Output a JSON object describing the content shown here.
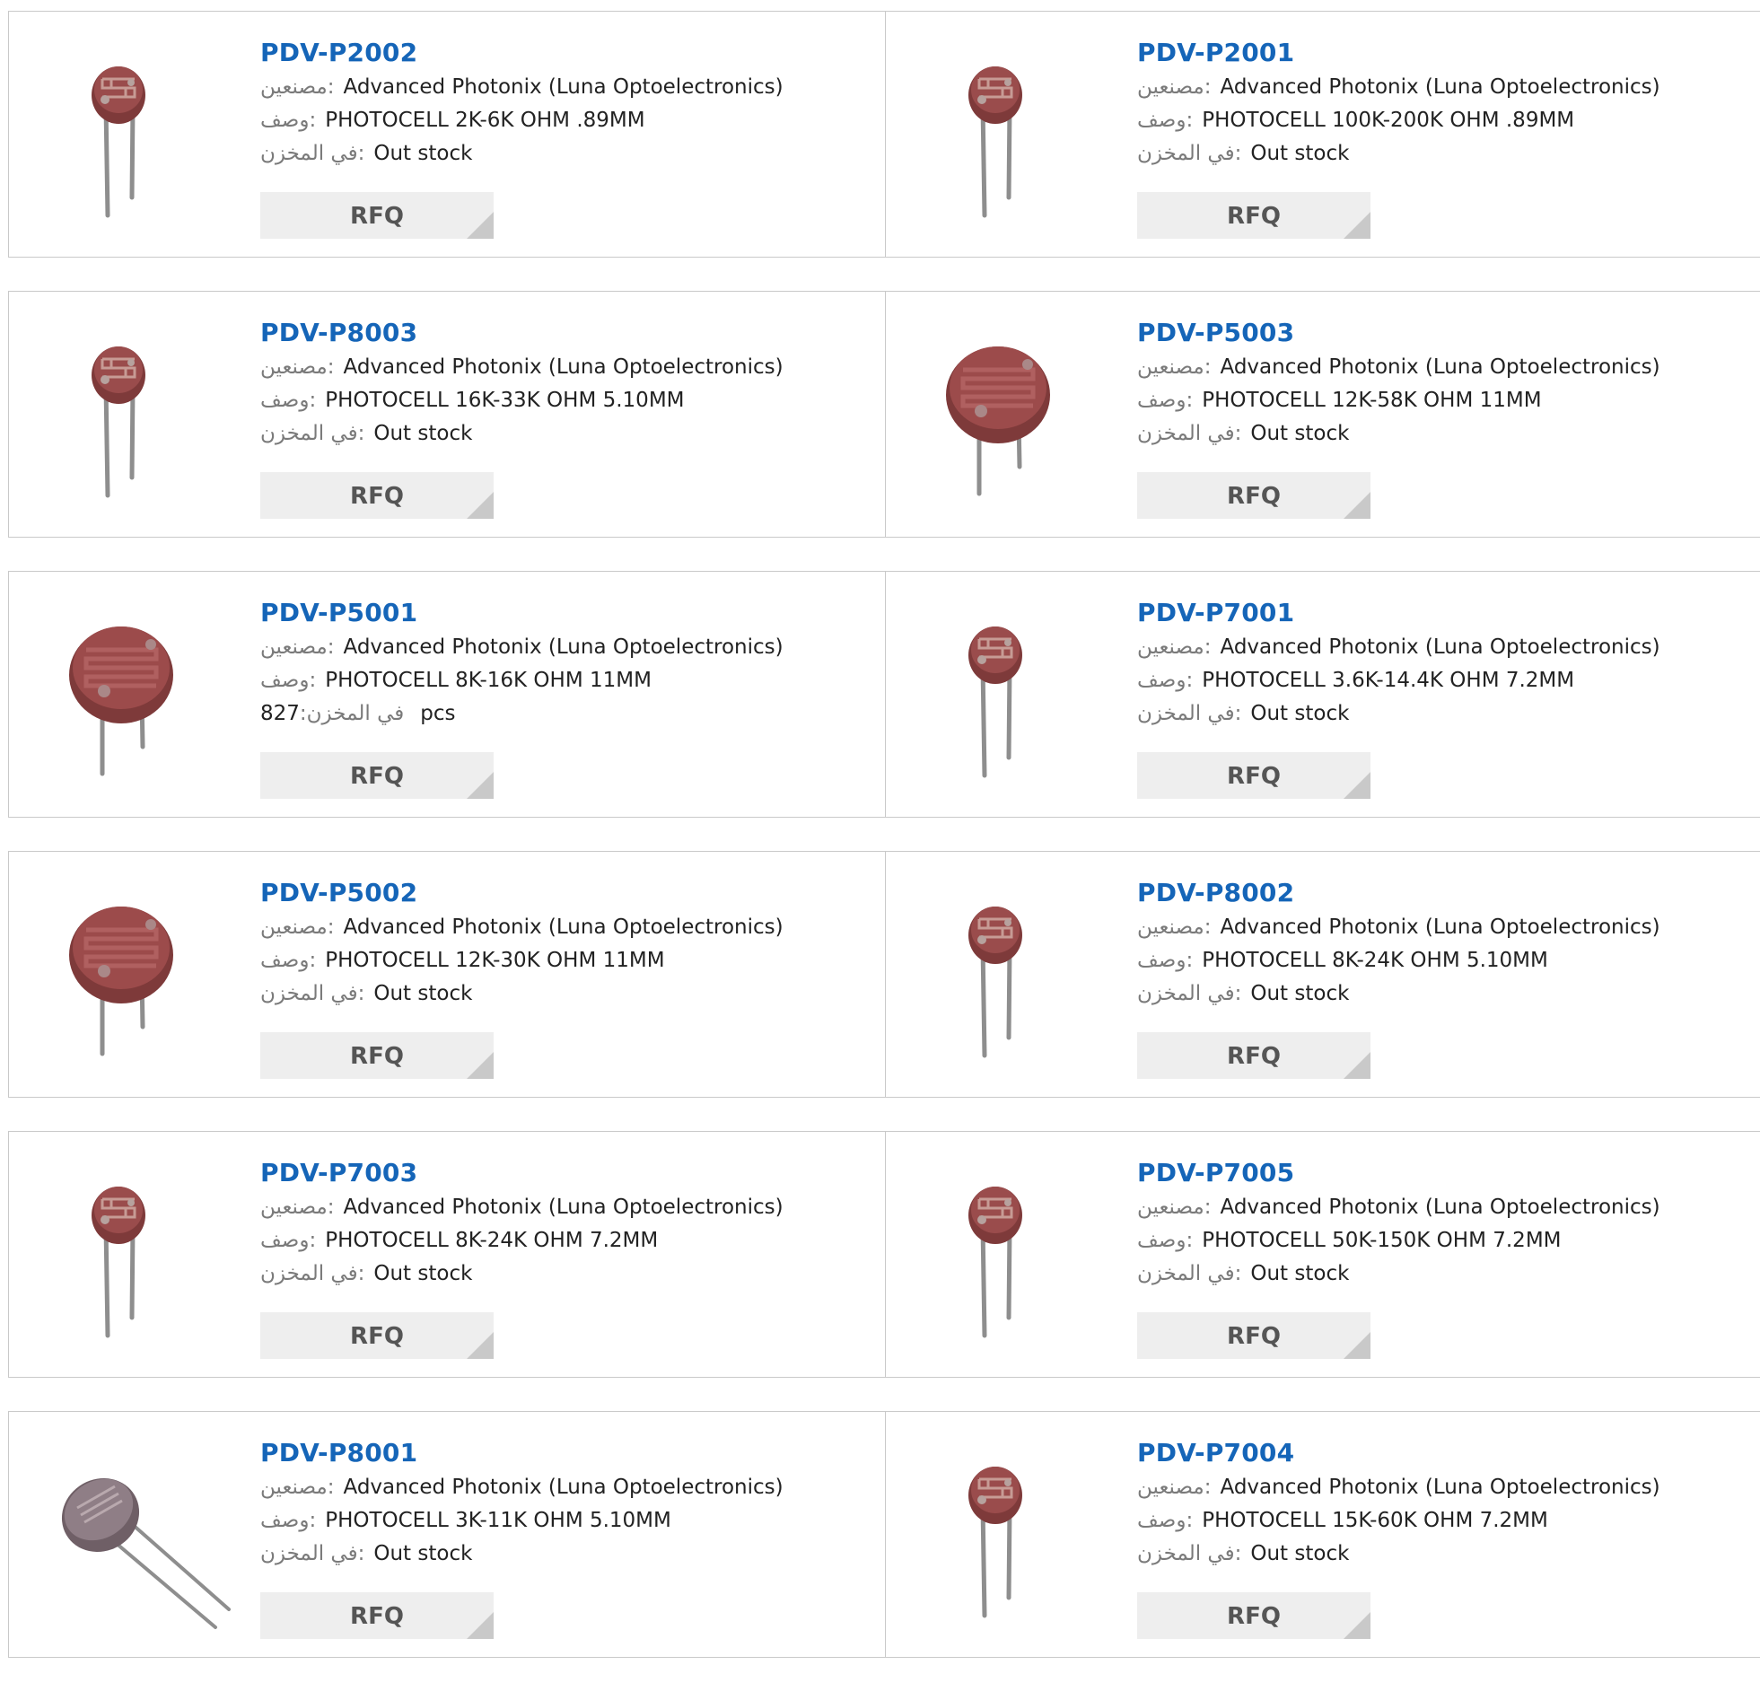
{
  "labels": {
    "manufacturer": "مصنعين:",
    "description": "وصف:",
    "stock": "في المخزن:"
  },
  "products": [
    {
      "part": "PDV-P2002",
      "manufacturer": "Advanced Photonix (Luna Optoelectronics)",
      "description": "PHOTOCELL 2K-6K OHM .89MM",
      "stock": "Out stock",
      "qty": "",
      "unit": "",
      "button": "RFQ",
      "image": "photocell-small-icon"
    },
    {
      "part": "PDV-P2001",
      "manufacturer": "Advanced Photonix (Luna Optoelectronics)",
      "description": "PHOTOCELL 100K-200K OHM .89MM",
      "stock": "Out stock",
      "qty": "",
      "unit": "",
      "button": "RFQ",
      "image": "photocell-small-icon"
    },
    {
      "part": "PDV-P8003",
      "manufacturer": "Advanced Photonix (Luna Optoelectronics)",
      "description": "PHOTOCELL 16K-33K OHM 5.10MM",
      "stock": "Out stock",
      "qty": "",
      "unit": "",
      "button": "RFQ",
      "image": "photocell-small-icon"
    },
    {
      "part": "PDV-P5003",
      "manufacturer": "Advanced Photonix (Luna Optoelectronics)",
      "description": "PHOTOCELL 12K-58K OHM 11MM",
      "stock": "Out stock",
      "qty": "",
      "unit": "",
      "button": "RFQ",
      "image": "photocell-large-icon"
    },
    {
      "part": "PDV-P5001",
      "manufacturer": "Advanced Photonix (Luna Optoelectronics)",
      "description": "PHOTOCELL 8K-16K OHM 11MM",
      "stock": "",
      "qty": "827",
      "unit": "pcs",
      "button": "RFQ",
      "image": "photocell-large-icon"
    },
    {
      "part": "PDV-P7001",
      "manufacturer": "Advanced Photonix (Luna Optoelectronics)",
      "description": "PHOTOCELL 3.6K-14.4K OHM 7.2MM",
      "stock": "Out stock",
      "qty": "",
      "unit": "",
      "button": "RFQ",
      "image": "photocell-small-icon"
    },
    {
      "part": "PDV-P5002",
      "manufacturer": "Advanced Photonix (Luna Optoelectronics)",
      "description": "PHOTOCELL 12K-30K OHM 11MM",
      "stock": "Out stock",
      "qty": "",
      "unit": "",
      "button": "RFQ",
      "image": "photocell-large-icon"
    },
    {
      "part": "PDV-P8002",
      "manufacturer": "Advanced Photonix (Luna Optoelectronics)",
      "description": "PHOTOCELL 8K-24K OHM 5.10MM",
      "stock": "Out stock",
      "qty": "",
      "unit": "",
      "button": "RFQ",
      "image": "photocell-small-icon"
    },
    {
      "part": "PDV-P7003",
      "manufacturer": "Advanced Photonix (Luna Optoelectronics)",
      "description": "PHOTOCELL 8K-24K OHM 7.2MM",
      "stock": "Out stock",
      "qty": "",
      "unit": "",
      "button": "RFQ",
      "image": "photocell-small-icon"
    },
    {
      "part": "PDV-P7005",
      "manufacturer": "Advanced Photonix (Luna Optoelectronics)",
      "description": "PHOTOCELL 50K-150K OHM 7.2MM",
      "stock": "Out stock",
      "qty": "",
      "unit": "",
      "button": "RFQ",
      "image": "photocell-small-icon"
    },
    {
      "part": "PDV-P8001",
      "manufacturer": "Advanced Photonix (Luna Optoelectronics)",
      "description": "PHOTOCELL 3K-11K OHM 5.10MM",
      "stock": "Out stock",
      "qty": "",
      "unit": "",
      "button": "RFQ",
      "image": "photocell-angled-icon"
    },
    {
      "part": "PDV-P7004",
      "manufacturer": "Advanced Photonix (Luna Optoelectronics)",
      "description": "PHOTOCELL 15K-60K OHM 7.2MM",
      "stock": "Out stock",
      "qty": "",
      "unit": "",
      "button": "RFQ",
      "image": "photocell-small-icon"
    }
  ],
  "colors": {
    "part_link": "#1565b8",
    "label_gray": "#7a7a7a",
    "button_bg": "#eeeeee",
    "button_text": "#555555",
    "border": "#c9c9c9",
    "photocell_body": "#8a3f3f"
  }
}
